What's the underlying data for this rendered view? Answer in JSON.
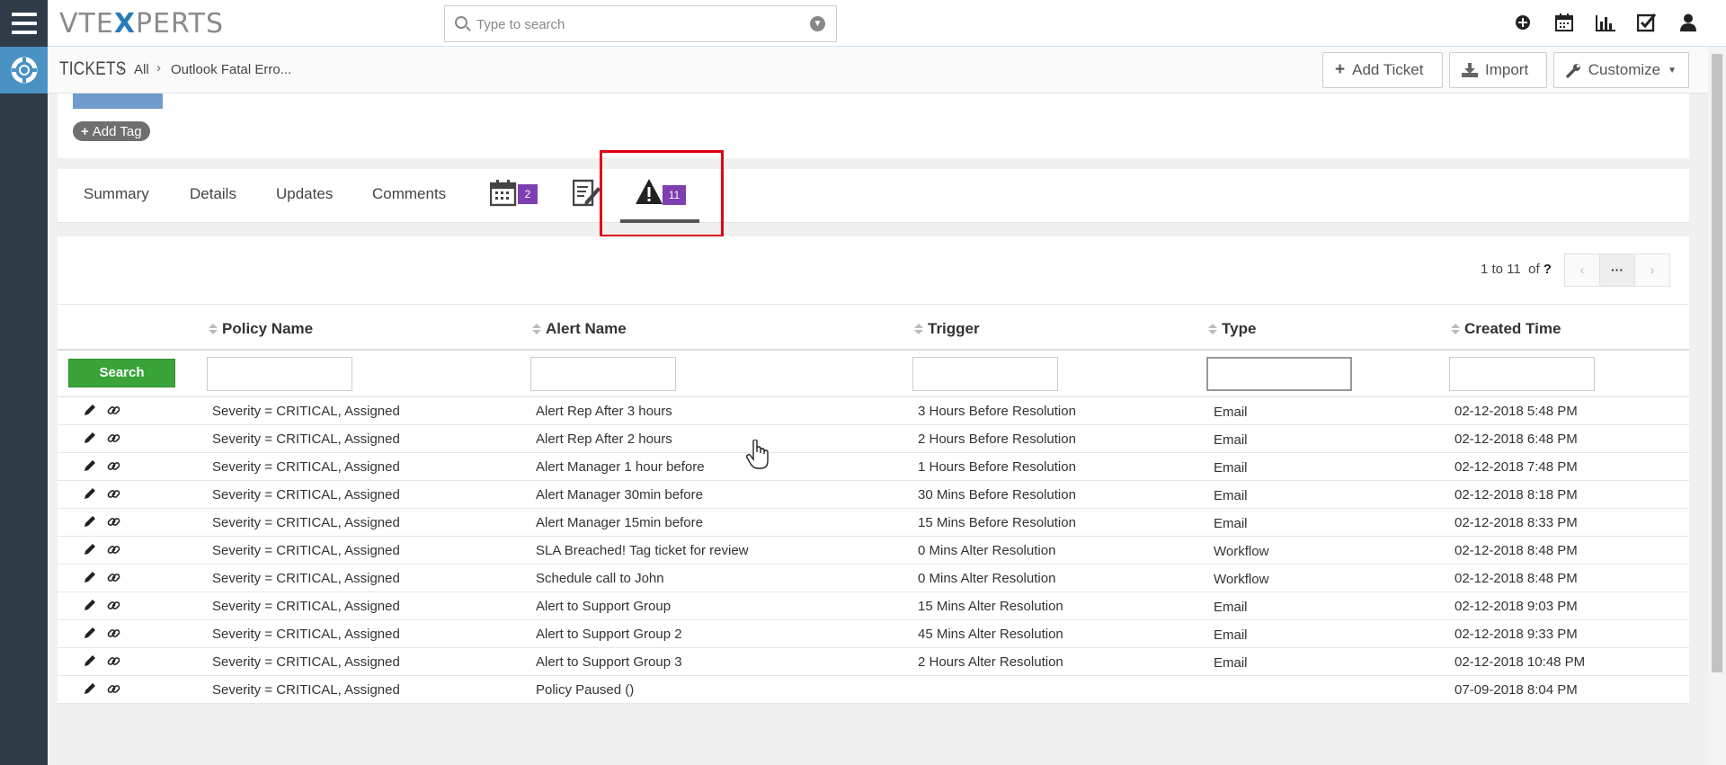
{
  "app": {
    "logo_left": "VTE",
    "logo_x": "X",
    "logo_right": "PERTS",
    "search_placeholder": "Type to search"
  },
  "header": {
    "module": "TICKETS",
    "crumb_all": "All",
    "crumb_record": "Outlook Fatal Erro...",
    "add_ticket": "Add Ticket",
    "import": "Import",
    "customize": "Customize"
  },
  "tags": {
    "add_tag": "Add Tag"
  },
  "tabs": {
    "summary": "Summary",
    "details": "Details",
    "updates": "Updates",
    "comments": "Comments",
    "calendar_count": "2",
    "alerts_count": "11"
  },
  "pager": {
    "range": "1 to 11",
    "of": "of",
    "total": "?",
    "more": "···"
  },
  "table": {
    "search_label": "Search",
    "columns": [
      "Policy Name",
      "Alert Name",
      "Trigger",
      "Type",
      "Created Time"
    ],
    "rows": [
      {
        "policy": "Severity = CRITICAL, Assigned",
        "alert": "Alert Rep After 3 hours",
        "trigger": "3 Hours Before Resolution",
        "type": "Email",
        "created": "02-12-2018 5:48 PM"
      },
      {
        "policy": "Severity = CRITICAL, Assigned",
        "alert": "Alert Rep After 2 hours",
        "trigger": "2 Hours Before Resolution",
        "type": "Email",
        "created": "02-12-2018 6:48 PM"
      },
      {
        "policy": "Severity = CRITICAL, Assigned",
        "alert": "Alert Manager 1 hour before",
        "trigger": "1 Hours Before Resolution",
        "type": "Email",
        "created": "02-12-2018 7:48 PM"
      },
      {
        "policy": "Severity = CRITICAL, Assigned",
        "alert": "Alert Manager 30min before",
        "trigger": "30 Mins Before Resolution",
        "type": "Email",
        "created": "02-12-2018 8:18 PM"
      },
      {
        "policy": "Severity = CRITICAL, Assigned",
        "alert": "Alert Manager 15min before",
        "trigger": "15 Mins Before Resolution",
        "type": "Email",
        "created": "02-12-2018 8:33 PM"
      },
      {
        "policy": "Severity = CRITICAL, Assigned",
        "alert": "SLA Breached! Tag ticket for review",
        "trigger": "0 Mins Alter Resolution",
        "type": "Workflow",
        "created": "02-12-2018 8:48 PM"
      },
      {
        "policy": "Severity = CRITICAL, Assigned",
        "alert": "Schedule call to John",
        "trigger": "0 Mins Alter Resolution",
        "type": "Workflow",
        "created": "02-12-2018 8:48 PM"
      },
      {
        "policy": "Severity = CRITICAL, Assigned",
        "alert": "Alert to Support Group",
        "trigger": "15 Mins Alter Resolution",
        "type": "Email",
        "created": "02-12-2018 9:03 PM"
      },
      {
        "policy": "Severity = CRITICAL, Assigned",
        "alert": "Alert to Support Group 2",
        "trigger": "45 Mins Alter Resolution",
        "type": "Email",
        "created": "02-12-2018 9:33 PM"
      },
      {
        "policy": "Severity = CRITICAL, Assigned",
        "alert": "Alert to Support Group 3",
        "trigger": "2 Hours Alter Resolution",
        "type": "Email",
        "created": "02-12-2018 10:48 PM"
      },
      {
        "policy": "Severity = CRITICAL, Assigned",
        "alert": "Policy Paused ()",
        "trigger": "",
        "type": "",
        "created": "07-09-2018 8:04 PM"
      }
    ]
  },
  "colors": {
    "sidebar": "#2f3b47",
    "accent": "#4a92c4",
    "badge": "#7d3fb2",
    "search_button": "#3aa43a",
    "highlight": "#e00012"
  }
}
